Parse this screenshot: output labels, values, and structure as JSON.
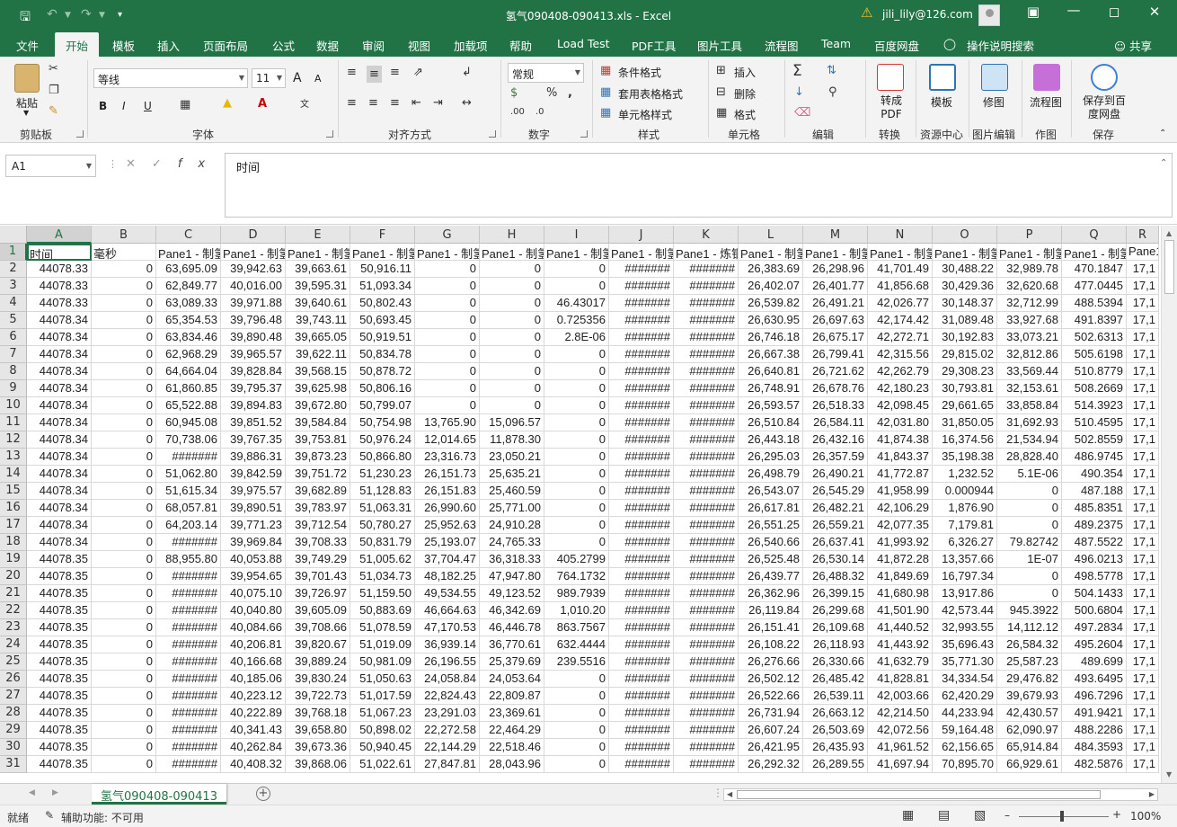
{
  "window": {
    "title": "氢气090408-090413.xls  -  Excel",
    "account": "jili_lily@126.com"
  },
  "menu_tabs": [
    "文件",
    "开始",
    "模板",
    "插入",
    "页面布局",
    "公式",
    "数据",
    "审阅",
    "视图",
    "加载项",
    "帮助",
    "Load Test",
    "PDF工具",
    "图片工具",
    "流程图",
    "Team",
    "百度网盘"
  ],
  "tell_me": "操作说明搜索",
  "share": "共享",
  "ribbon": {
    "clipboard": {
      "label": "剪贴板",
      "paste": "粘贴"
    },
    "font": {
      "label": "字体",
      "name": "等线",
      "size": "11",
      "bold": "B",
      "italic": "I",
      "underline": "U",
      "grow": "A",
      "shrink": "A"
    },
    "alignment": {
      "label": "对齐方式"
    },
    "number": {
      "label": "数字",
      "format": "常规"
    },
    "styles": {
      "label": "样式",
      "conditional": "条件格式",
      "table": "套用表格格式",
      "cell": "单元格样式"
    },
    "cells": {
      "label": "单元格",
      "insert": "插入",
      "delete": "删除",
      "format": "格式"
    },
    "editing": {
      "label": "编辑"
    },
    "convert": {
      "label": "转换",
      "button": "转成PDF"
    },
    "resource": {
      "label": "资源中心",
      "button": "模板"
    },
    "picedit": {
      "label": "图片编辑",
      "button": "修图"
    },
    "draw": {
      "label": "作图",
      "button": "流程图"
    },
    "save": {
      "label": "保存",
      "button": "保存到百度网盘"
    }
  },
  "name_box": "A1",
  "formula": "时间",
  "columns": [
    "A",
    "B",
    "C",
    "D",
    "E",
    "F",
    "G",
    "H",
    "I",
    "J",
    "K",
    "L",
    "M",
    "N",
    "O",
    "P",
    "Q",
    "R"
  ],
  "header_row": [
    "时间",
    "毫秒",
    "Pane1 - 制氢",
    "Pane1 - 制氢",
    "Pane1 - 制氢",
    "Pane1 - 制氢",
    "Pane1 - 制氢",
    "Pane1 - 制氢",
    "Pane1 - 制氢",
    "Pane1 - 制氢",
    "Pane1 - 炼钢",
    "Pane1 - 制氢",
    "Pane1 - 制氢",
    "Pane1 - 制氢",
    "Pane1 - 制氢",
    "Pane1 - 制氢",
    "Pane1 - 制氢",
    "Pane1 -"
  ],
  "rows": [
    [
      "44078.33",
      "0",
      "63,695.09",
      "39,942.63",
      "39,663.61",
      "50,916.11",
      "0",
      "0",
      "0",
      "#######",
      "#######",
      "26,383.69",
      "26,298.96",
      "41,701.49",
      "30,488.22",
      "32,989.78",
      "470.1847",
      "17,1"
    ],
    [
      "44078.33",
      "0",
      "62,849.77",
      "40,016.00",
      "39,595.31",
      "51,093.34",
      "0",
      "0",
      "0",
      "#######",
      "#######",
      "26,402.07",
      "26,401.77",
      "41,856.68",
      "30,429.36",
      "32,620.68",
      "477.0445",
      "17,1"
    ],
    [
      "44078.33",
      "0",
      "63,089.33",
      "39,971.88",
      "39,640.61",
      "50,802.43",
      "0",
      "0",
      "46.43017",
      "#######",
      "#######",
      "26,539.82",
      "26,491.21",
      "42,026.77",
      "30,148.37",
      "32,712.99",
      "488.5394",
      "17,1"
    ],
    [
      "44078.34",
      "0",
      "65,354.53",
      "39,796.48",
      "39,743.11",
      "50,693.45",
      "0",
      "0",
      "0.725356",
      "#######",
      "#######",
      "26,630.95",
      "26,697.63",
      "42,174.42",
      "31,089.48",
      "33,927.68",
      "491.8397",
      "17,1"
    ],
    [
      "44078.34",
      "0",
      "63,834.46",
      "39,890.48",
      "39,665.05",
      "50,919.51",
      "0",
      "0",
      "2.8E-06",
      "#######",
      "#######",
      "26,746.18",
      "26,675.17",
      "42,272.71",
      "30,192.83",
      "33,073.21",
      "502.6313",
      "17,1"
    ],
    [
      "44078.34",
      "0",
      "62,968.29",
      "39,965.57",
      "39,622.11",
      "50,834.78",
      "0",
      "0",
      "0",
      "#######",
      "#######",
      "26,667.38",
      "26,799.41",
      "42,315.56",
      "29,815.02",
      "32,812.86",
      "505.6198",
      "17,1"
    ],
    [
      "44078.34",
      "0",
      "64,664.04",
      "39,828.84",
      "39,568.15",
      "50,878.72",
      "0",
      "0",
      "0",
      "#######",
      "#######",
      "26,640.81",
      "26,721.62",
      "42,262.79",
      "29,308.23",
      "33,569.44",
      "510.8779",
      "17,1"
    ],
    [
      "44078.34",
      "0",
      "61,860.85",
      "39,795.37",
      "39,625.98",
      "50,806.16",
      "0",
      "0",
      "0",
      "#######",
      "#######",
      "26,748.91",
      "26,678.76",
      "42,180.23",
      "30,793.81",
      "32,153.61",
      "508.2669",
      "17,1"
    ],
    [
      "44078.34",
      "0",
      "65,522.88",
      "39,894.83",
      "39,672.80",
      "50,799.07",
      "0",
      "0",
      "0",
      "#######",
      "#######",
      "26,593.57",
      "26,518.33",
      "42,098.45",
      "29,661.65",
      "33,858.84",
      "514.3923",
      "17,1"
    ],
    [
      "44078.34",
      "0",
      "60,945.08",
      "39,851.52",
      "39,584.84",
      "50,754.98",
      "13,765.90",
      "15,096.57",
      "0",
      "#######",
      "#######",
      "26,510.84",
      "26,584.11",
      "42,031.80",
      "31,850.05",
      "31,692.93",
      "510.4595",
      "17,1"
    ],
    [
      "44078.34",
      "0",
      "70,738.06",
      "39,767.35",
      "39,753.81",
      "50,976.24",
      "12,014.65",
      "11,878.30",
      "0",
      "#######",
      "#######",
      "26,443.18",
      "26,432.16",
      "41,874.38",
      "16,374.56",
      "21,534.94",
      "502.8559",
      "17,1"
    ],
    [
      "44078.34",
      "0",
      "#######",
      "39,886.31",
      "39,873.23",
      "50,866.80",
      "23,316.73",
      "23,050.21",
      "0",
      "#######",
      "#######",
      "26,295.03",
      "26,357.59",
      "41,843.37",
      "35,198.38",
      "28,828.40",
      "486.9745",
      "17,1"
    ],
    [
      "44078.34",
      "0",
      "51,062.80",
      "39,842.59",
      "39,751.72",
      "51,230.23",
      "26,151.73",
      "25,635.21",
      "0",
      "#######",
      "#######",
      "26,498.79",
      "26,490.21",
      "41,772.87",
      "1,232.52",
      "5.1E-06",
      "490.354",
      "17,1"
    ],
    [
      "44078.34",
      "0",
      "51,615.34",
      "39,975.57",
      "39,682.89",
      "51,128.83",
      "26,151.83",
      "25,460.59",
      "0",
      "#######",
      "#######",
      "26,543.07",
      "26,545.29",
      "41,958.99",
      "0.000944",
      "0",
      "487.188",
      "17,1"
    ],
    [
      "44078.34",
      "0",
      "68,057.81",
      "39,890.51",
      "39,783.97",
      "51,063.31",
      "26,990.60",
      "25,771.00",
      "0",
      "#######",
      "#######",
      "26,617.81",
      "26,482.21",
      "42,106.29",
      "1,876.90",
      "0",
      "485.8351",
      "17,1"
    ],
    [
      "44078.34",
      "0",
      "64,203.14",
      "39,771.23",
      "39,712.54",
      "50,780.27",
      "25,952.63",
      "24,910.28",
      "0",
      "#######",
      "#######",
      "26,551.25",
      "26,559.21",
      "42,077.35",
      "7,179.81",
      "0",
      "489.2375",
      "17,1"
    ],
    [
      "44078.34",
      "0",
      "#######",
      "39,969.84",
      "39,708.33",
      "50,831.79",
      "25,193.07",
      "24,765.33",
      "0",
      "#######",
      "#######",
      "26,540.66",
      "26,637.41",
      "41,993.92",
      "6,326.27",
      "79.82742",
      "487.5522",
      "17,1"
    ],
    [
      "44078.35",
      "0",
      "88,955.80",
      "40,053.88",
      "39,749.29",
      "51,005.62",
      "37,704.47",
      "36,318.33",
      "405.2799",
      "#######",
      "#######",
      "26,525.48",
      "26,530.14",
      "41,872.28",
      "13,357.66",
      "1E-07",
      "496.0213",
      "17,1"
    ],
    [
      "44078.35",
      "0",
      "#######",
      "39,954.65",
      "39,701.43",
      "51,034.73",
      "48,182.25",
      "47,947.80",
      "764.1732",
      "#######",
      "#######",
      "26,439.77",
      "26,488.32",
      "41,849.69",
      "16,797.34",
      "0",
      "498.5778",
      "17,1"
    ],
    [
      "44078.35",
      "0",
      "#######",
      "40,075.10",
      "39,726.97",
      "51,159.50",
      "49,534.55",
      "49,123.52",
      "989.7939",
      "#######",
      "#######",
      "26,362.96",
      "26,399.15",
      "41,680.98",
      "13,917.86",
      "0",
      "504.1433",
      "17,1"
    ],
    [
      "44078.35",
      "0",
      "#######",
      "40,040.80",
      "39,605.09",
      "50,883.69",
      "46,664.63",
      "46,342.69",
      "1,010.20",
      "#######",
      "#######",
      "26,119.84",
      "26,299.68",
      "41,501.90",
      "42,573.44",
      "945.3922",
      "500.6804",
      "17,1"
    ],
    [
      "44078.35",
      "0",
      "#######",
      "40,084.66",
      "39,708.66",
      "51,078.59",
      "47,170.53",
      "46,446.78",
      "863.7567",
      "#######",
      "#######",
      "26,151.41",
      "26,109.68",
      "41,440.52",
      "32,993.55",
      "14,112.12",
      "497.2834",
      "17,1"
    ],
    [
      "44078.35",
      "0",
      "#######",
      "40,206.81",
      "39,820.67",
      "51,019.09",
      "36,939.14",
      "36,770.61",
      "632.4444",
      "#######",
      "#######",
      "26,108.22",
      "26,118.93",
      "41,443.92",
      "35,696.43",
      "26,584.32",
      "495.2604",
      "17,1"
    ],
    [
      "44078.35",
      "0",
      "#######",
      "40,166.68",
      "39,889.24",
      "50,981.09",
      "26,196.55",
      "25,379.69",
      "239.5516",
      "#######",
      "#######",
      "26,276.66",
      "26,330.66",
      "41,632.79",
      "35,771.30",
      "25,587.23",
      "489.699",
      "17,1"
    ],
    [
      "44078.35",
      "0",
      "#######",
      "40,185.06",
      "39,830.24",
      "51,050.63",
      "24,058.84",
      "24,053.64",
      "0",
      "#######",
      "#######",
      "26,502.12",
      "26,485.42",
      "41,828.81",
      "34,334.54",
      "29,476.82",
      "493.6495",
      "17,1"
    ],
    [
      "44078.35",
      "0",
      "#######",
      "40,223.12",
      "39,722.73",
      "51,017.59",
      "22,824.43",
      "22,809.87",
      "0",
      "#######",
      "#######",
      "26,522.66",
      "26,539.11",
      "42,003.66",
      "62,420.29",
      "39,679.93",
      "496.7296",
      "17,1"
    ],
    [
      "44078.35",
      "0",
      "#######",
      "40,222.89",
      "39,768.18",
      "51,067.23",
      "23,291.03",
      "23,369.61",
      "0",
      "#######",
      "#######",
      "26,731.94",
      "26,663.12",
      "42,214.50",
      "44,233.94",
      "42,430.57",
      "491.9421",
      "17,1"
    ],
    [
      "44078.35",
      "0",
      "#######",
      "40,341.43",
      "39,658.80",
      "50,898.02",
      "22,272.58",
      "22,464.29",
      "0",
      "#######",
      "#######",
      "26,607.24",
      "26,503.69",
      "42,072.56",
      "59,164.48",
      "62,090.97",
      "488.2286",
      "17,1"
    ],
    [
      "44078.35",
      "0",
      "#######",
      "40,262.84",
      "39,673.36",
      "50,940.45",
      "22,144.29",
      "22,518.46",
      "0",
      "#######",
      "#######",
      "26,421.95",
      "26,435.93",
      "41,961.52",
      "62,156.65",
      "65,914.84",
      "484.3593",
      "17,1"
    ],
    [
      "44078.35",
      "0",
      "#######",
      "40,408.32",
      "39,868.06",
      "51,022.61",
      "27,847.81",
      "28,043.96",
      "0",
      "#######",
      "#######",
      "26,292.32",
      "26,289.55",
      "41,697.94",
      "70,895.70",
      "66,929.61",
      "482.5876",
      "17,1"
    ]
  ],
  "sheet_tab": "氢气090408-090413",
  "status": {
    "ready": "就绪",
    "accessibility": "辅助功能: 不可用",
    "zoom": "100%"
  }
}
